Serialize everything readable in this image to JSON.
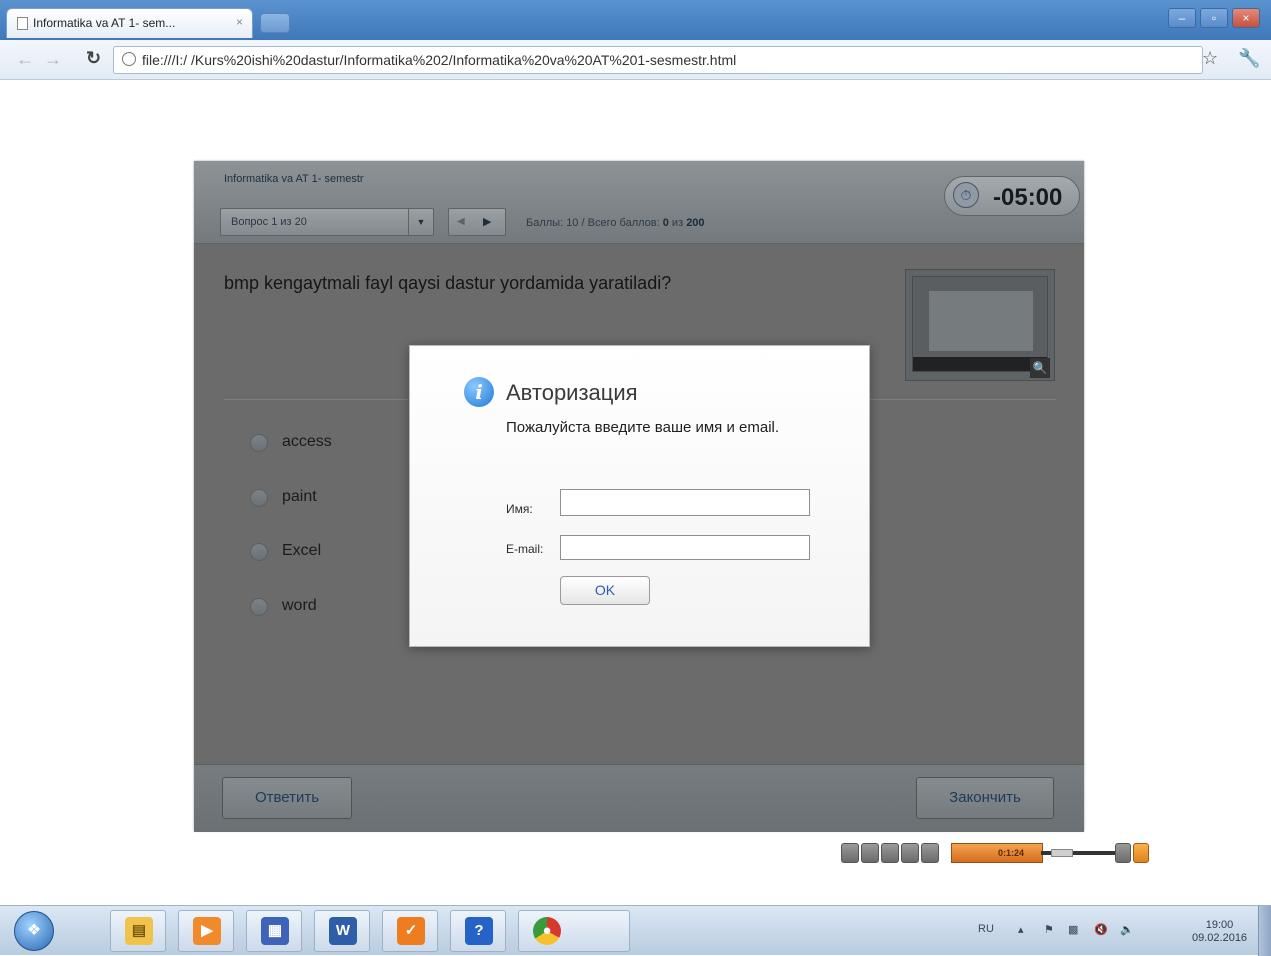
{
  "browser": {
    "tab_title": "Informatika va AT 1- sem...",
    "tab_close": "×",
    "url": "file:///I:/ /Kurs%20ishi%20dastur/Informatika%202/Informatika%20va%20AT%201-sesmestr.html",
    "window_buttons": [
      "–",
      "▫",
      "×"
    ]
  },
  "quiz": {
    "title": "Informatika va AT 1- semestr",
    "question_select": "Вопрос 1 из 20",
    "score_label": "Баллы: 10",
    "separator": "/",
    "total_label": "Всего баллов:",
    "total_value": "0",
    "total_of": "из",
    "total_max": "200",
    "timer": "-05:00",
    "question": "bmp kengaytmali fayl qaysi dastur yordamida yaratiladi?",
    "options": [
      "access",
      "paint",
      "Excel",
      "word"
    ],
    "answer_button": "Ответить",
    "finish_button": "Закончить"
  },
  "modal": {
    "title": "Авторизация",
    "message": "Пожалуйста введите ваше имя и email.",
    "name_label": "Имя:",
    "email_label": "E-mail:",
    "name_value": "",
    "email_value": "",
    "ok_button": "OK"
  },
  "player_controls": {
    "time": "0:1:24"
  },
  "taskbar": {
    "language": "RU",
    "time": "19:00",
    "date": "09.02.2016"
  },
  "colors": {
    "overlay_gray": "#6b6b6b",
    "info_icon": "#1f79d6",
    "button_text": "#1e3a5f",
    "ok_text": "#2b5fae",
    "progress_orange": "#e58535"
  },
  "icons": {
    "info": "info-icon",
    "timer": "stopwatch-icon",
    "star": "star-icon",
    "wrench": "wrench-icon"
  }
}
